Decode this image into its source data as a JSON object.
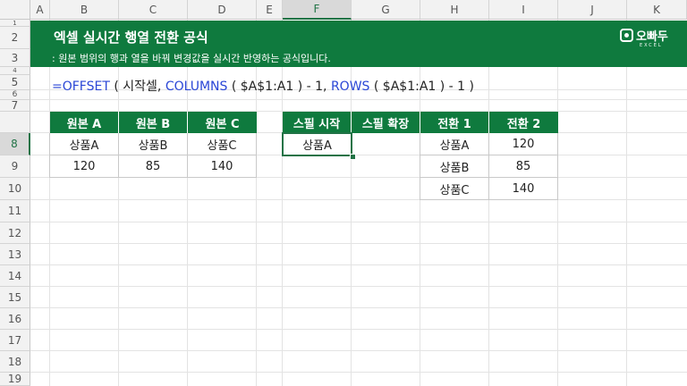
{
  "columns": [
    "A",
    "B",
    "C",
    "D",
    "E",
    "F",
    "G",
    "H",
    "I",
    "J",
    "K"
  ],
  "selected_column": "F",
  "rows": [
    "1",
    "2",
    "3",
    "4",
    "5",
    "6",
    "7",
    "8",
    "9",
    "10",
    "11",
    "12",
    "13",
    "14",
    "15",
    "16",
    "17",
    "18",
    "19"
  ],
  "selected_row": "8",
  "banner": {
    "title": "엑셀 실시간 행열 전환 공식",
    "subtitle": ": 원본 범위의 행과 열을 바꿔 변경값을 실시간 반영하는 공식입니다.",
    "logo_name": "오빠두",
    "logo_sub": "EXCEL",
    "color": "#0f7a3e"
  },
  "formula": {
    "p1": "=OFFSET",
    "p2": " ( 시작셀, ",
    "p3": "COLUMNS",
    "p4": " ( $A$1:A1 ) - 1, ",
    "p5": "ROWS",
    "p6": " ( $A$1:A1 ) - 1 )"
  },
  "source_table": {
    "headers": [
      "원본 A",
      "원본 B",
      "원본 C"
    ],
    "row1": [
      "상품A",
      "상품B",
      "상품C"
    ],
    "row2": [
      "120",
      "85",
      "140"
    ]
  },
  "spill": {
    "headers": [
      "스필 시작",
      "스필 확장"
    ],
    "value": "상품A"
  },
  "transposed": {
    "headers": [
      "전환 1",
      "전환 2"
    ],
    "rows": [
      [
        "상품A",
        "120"
      ],
      [
        "상품B",
        "85"
      ],
      [
        "상품C",
        "140"
      ]
    ]
  }
}
